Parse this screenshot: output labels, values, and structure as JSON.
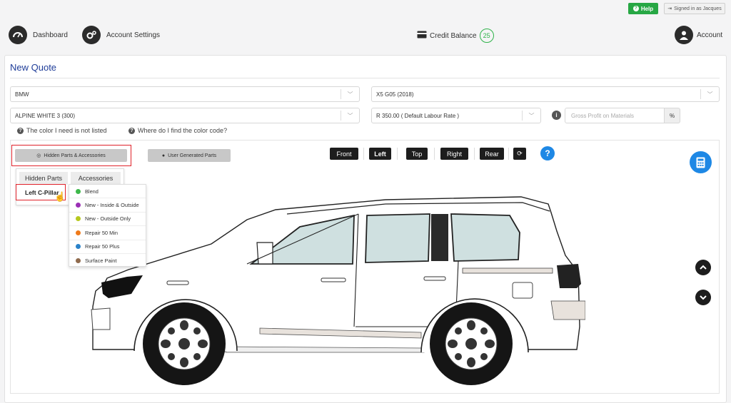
{
  "topbar": {
    "help_label": "Help",
    "signed_in_label": "Signed in as Jacques"
  },
  "nav": {
    "dashboard_label": "Dashboard",
    "account_settings_label": "Account Settings",
    "credit_label": "Credit Balance",
    "credit_value": "25",
    "account_label": "Account"
  },
  "quote": {
    "title": "New Quote",
    "make": "BMW",
    "model": "X5 G05 (2018)",
    "color": "ALPINE WHITE 3 (300)",
    "labour_rate": "R 350.00 ( Default Labour Rate )",
    "gross_profit_placeholder": "Gross Profit on Materials",
    "percent_label": "%",
    "color_not_listed": "The color I need is not listed",
    "where_color_code": "Where do I find the color code?"
  },
  "toolbar": {
    "hidden_parts_button": "Hidden Parts & Accessories",
    "user_parts_button": "User Generated Parts",
    "views": [
      "Front",
      "Left",
      "Top",
      "Right",
      "Rear"
    ],
    "active_view": "Left",
    "help_q": "?"
  },
  "dropdown": {
    "tabs": [
      "Hidden Parts",
      "Accessories"
    ],
    "hidden_part": "Left C-Pillar",
    "accessories": [
      {
        "label": "Blend",
        "color": "#3db84a"
      },
      {
        "label": "New - Inside & Outside",
        "color": "#9b2fb5"
      },
      {
        "label": "New - Outside Only",
        "color": "#b6c81e"
      },
      {
        "label": "Repair 50 Min",
        "color": "#ef7a1a"
      },
      {
        "label": "Repair 50 Plus",
        "color": "#2a82c9"
      },
      {
        "label": "Surface Paint",
        "color": "#8f6a4d"
      }
    ]
  },
  "icons": {
    "help": "question-circle-icon",
    "signed_in": "sign-in-icon",
    "dashboard": "speedometer-icon",
    "account_settings": "gears-icon",
    "credit": "credit-card-icon",
    "account": "user-icon",
    "calculator": "calculator-icon",
    "reset": "refresh-icon",
    "up": "chevron-up-icon",
    "down": "chevron-down-icon"
  }
}
